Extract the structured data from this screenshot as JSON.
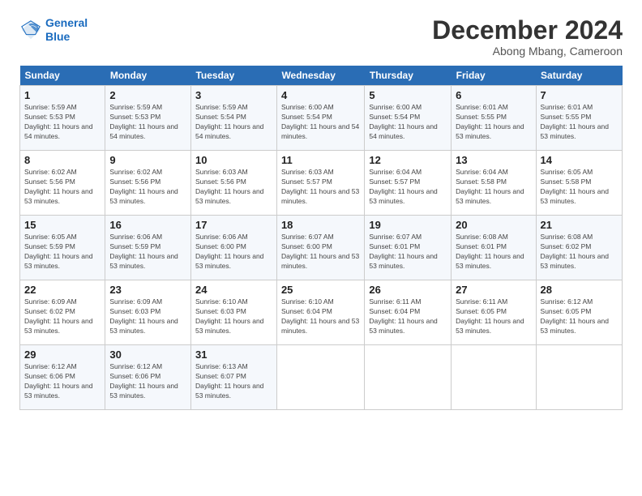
{
  "logo": {
    "line1": "General",
    "line2": "Blue"
  },
  "title": "December 2024",
  "subtitle": "Abong Mbang, Cameroon",
  "weekdays": [
    "Sunday",
    "Monday",
    "Tuesday",
    "Wednesday",
    "Thursday",
    "Friday",
    "Saturday"
  ],
  "weeks": [
    [
      {
        "day": "1",
        "sunrise": "5:59 AM",
        "sunset": "5:53 PM",
        "daylight": "11 hours and 54 minutes."
      },
      {
        "day": "2",
        "sunrise": "5:59 AM",
        "sunset": "5:53 PM",
        "daylight": "11 hours and 54 minutes."
      },
      {
        "day": "3",
        "sunrise": "5:59 AM",
        "sunset": "5:54 PM",
        "daylight": "11 hours and 54 minutes."
      },
      {
        "day": "4",
        "sunrise": "6:00 AM",
        "sunset": "5:54 PM",
        "daylight": "11 hours and 54 minutes."
      },
      {
        "day": "5",
        "sunrise": "6:00 AM",
        "sunset": "5:54 PM",
        "daylight": "11 hours and 54 minutes."
      },
      {
        "day": "6",
        "sunrise": "6:01 AM",
        "sunset": "5:55 PM",
        "daylight": "11 hours and 53 minutes."
      },
      {
        "day": "7",
        "sunrise": "6:01 AM",
        "sunset": "5:55 PM",
        "daylight": "11 hours and 53 minutes."
      }
    ],
    [
      {
        "day": "8",
        "sunrise": "6:02 AM",
        "sunset": "5:56 PM",
        "daylight": "11 hours and 53 minutes."
      },
      {
        "day": "9",
        "sunrise": "6:02 AM",
        "sunset": "5:56 PM",
        "daylight": "11 hours and 53 minutes."
      },
      {
        "day": "10",
        "sunrise": "6:03 AM",
        "sunset": "5:56 PM",
        "daylight": "11 hours and 53 minutes."
      },
      {
        "day": "11",
        "sunrise": "6:03 AM",
        "sunset": "5:57 PM",
        "daylight": "11 hours and 53 minutes."
      },
      {
        "day": "12",
        "sunrise": "6:04 AM",
        "sunset": "5:57 PM",
        "daylight": "11 hours and 53 minutes."
      },
      {
        "day": "13",
        "sunrise": "6:04 AM",
        "sunset": "5:58 PM",
        "daylight": "11 hours and 53 minutes."
      },
      {
        "day": "14",
        "sunrise": "6:05 AM",
        "sunset": "5:58 PM",
        "daylight": "11 hours and 53 minutes."
      }
    ],
    [
      {
        "day": "15",
        "sunrise": "6:05 AM",
        "sunset": "5:59 PM",
        "daylight": "11 hours and 53 minutes."
      },
      {
        "day": "16",
        "sunrise": "6:06 AM",
        "sunset": "5:59 PM",
        "daylight": "11 hours and 53 minutes."
      },
      {
        "day": "17",
        "sunrise": "6:06 AM",
        "sunset": "6:00 PM",
        "daylight": "11 hours and 53 minutes."
      },
      {
        "day": "18",
        "sunrise": "6:07 AM",
        "sunset": "6:00 PM",
        "daylight": "11 hours and 53 minutes."
      },
      {
        "day": "19",
        "sunrise": "6:07 AM",
        "sunset": "6:01 PM",
        "daylight": "11 hours and 53 minutes."
      },
      {
        "day": "20",
        "sunrise": "6:08 AM",
        "sunset": "6:01 PM",
        "daylight": "11 hours and 53 minutes."
      },
      {
        "day": "21",
        "sunrise": "6:08 AM",
        "sunset": "6:02 PM",
        "daylight": "11 hours and 53 minutes."
      }
    ],
    [
      {
        "day": "22",
        "sunrise": "6:09 AM",
        "sunset": "6:02 PM",
        "daylight": "11 hours and 53 minutes."
      },
      {
        "day": "23",
        "sunrise": "6:09 AM",
        "sunset": "6:03 PM",
        "daylight": "11 hours and 53 minutes."
      },
      {
        "day": "24",
        "sunrise": "6:10 AM",
        "sunset": "6:03 PM",
        "daylight": "11 hours and 53 minutes."
      },
      {
        "day": "25",
        "sunrise": "6:10 AM",
        "sunset": "6:04 PM",
        "daylight": "11 hours and 53 minutes."
      },
      {
        "day": "26",
        "sunrise": "6:11 AM",
        "sunset": "6:04 PM",
        "daylight": "11 hours and 53 minutes."
      },
      {
        "day": "27",
        "sunrise": "6:11 AM",
        "sunset": "6:05 PM",
        "daylight": "11 hours and 53 minutes."
      },
      {
        "day": "28",
        "sunrise": "6:12 AM",
        "sunset": "6:05 PM",
        "daylight": "11 hours and 53 minutes."
      }
    ],
    [
      {
        "day": "29",
        "sunrise": "6:12 AM",
        "sunset": "6:06 PM",
        "daylight": "11 hours and 53 minutes."
      },
      {
        "day": "30",
        "sunrise": "6:12 AM",
        "sunset": "6:06 PM",
        "daylight": "11 hours and 53 minutes."
      },
      {
        "day": "31",
        "sunrise": "6:13 AM",
        "sunset": "6:07 PM",
        "daylight": "11 hours and 53 minutes."
      },
      null,
      null,
      null,
      null
    ]
  ]
}
